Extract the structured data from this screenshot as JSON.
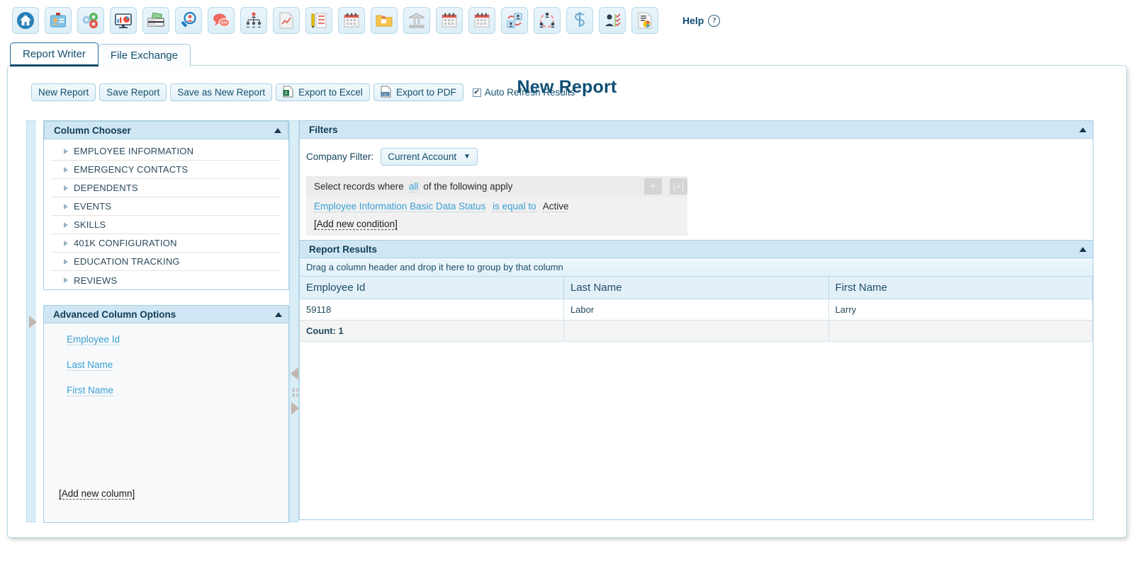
{
  "toolbar": {
    "icons": [
      {
        "name": "home-icon",
        "title": "Home"
      },
      {
        "name": "employee-badge-icon",
        "title": "Employee"
      },
      {
        "name": "settings-gears-icon",
        "title": "Configuration"
      },
      {
        "name": "dashboard-monitor-icon",
        "title": "Dashboard"
      },
      {
        "name": "payroll-money-icon",
        "title": "Payroll"
      },
      {
        "name": "search-person-icon",
        "title": "Search"
      },
      {
        "name": "chat-bubbles-icon",
        "title": "Messages"
      },
      {
        "name": "org-chart-icon",
        "title": "Org Chart"
      },
      {
        "name": "report-chart-icon",
        "title": "Reports"
      },
      {
        "name": "checklist-pen-icon",
        "title": "Checklist"
      },
      {
        "name": "calendar-icon",
        "title": "Calendar"
      },
      {
        "name": "folder-lock-icon",
        "title": "Secure Folder"
      },
      {
        "name": "bank-icon",
        "title": "Bank"
      },
      {
        "name": "calendar-icon-2",
        "title": "Schedule"
      },
      {
        "name": "calendar-icon-3",
        "title": "Attendance"
      },
      {
        "name": "performance-people-icon",
        "title": "Performance"
      },
      {
        "name": "recruiting-network-icon",
        "title": "Recruiting"
      },
      {
        "name": "benefits-caduceus-icon",
        "title": "Benefits"
      },
      {
        "name": "onboarding-check-icon",
        "title": "Onboarding"
      },
      {
        "name": "report-writer-icon",
        "title": "Report Writer"
      }
    ],
    "help_label": "Help",
    "help_icon": "question-mark-icon"
  },
  "tabs": [
    {
      "label": "Report Writer",
      "active": true
    },
    {
      "label": "File Exchange",
      "active": false
    }
  ],
  "actions": {
    "new_report": "New Report",
    "save_report": "Save Report",
    "save_as_new_report": "Save as New Report",
    "export_excel": "Export to Excel",
    "export_pdf": "Export to PDF",
    "auto_refresh": "Auto Refresh Results",
    "auto_refresh_checked": true
  },
  "page_title": "New Report",
  "column_chooser": {
    "header": "Column Chooser",
    "items": [
      "EMPLOYEE INFORMATION",
      "EMERGENCY CONTACTS",
      "DEPENDENTS",
      "EVENTS",
      "SKILLS",
      "401K CONFIGURATION",
      "EDUCATION TRACKING",
      "REVIEWS"
    ]
  },
  "advanced_column_options": {
    "header": "Advanced Column Options",
    "columns": [
      "Employee Id",
      "Last Name",
      "First Name"
    ],
    "add_link": "[Add new column]"
  },
  "filters": {
    "header": "Filters",
    "company_filter_label": "Company Filter:",
    "company_filter_value": "Current Account",
    "select_prefix": "Select records where",
    "match_mode": "all",
    "select_suffix": "of the following apply",
    "add_condition_button": "+",
    "add_group_button": "{+}",
    "conditions": [
      {
        "field": "Employee Information Basic Data Status",
        "operator": "is equal to",
        "value": "Active"
      }
    ],
    "add_condition_link": "[Add new condition]"
  },
  "report_results": {
    "header": "Report Results",
    "group_hint": "Drag a column header and drop it here to group by that column",
    "columns": [
      "Employee Id",
      "Last Name",
      "First Name"
    ],
    "rows": [
      [
        "59118",
        "Labor",
        "Larry"
      ]
    ],
    "footer": [
      "Count: 1",
      "",
      ""
    ]
  },
  "colors": {
    "accent": "#0e4f74",
    "panel_header_bg": "#cfe7f4",
    "link": "#3a9fd4",
    "grid_header_bg": "#e3f0f8"
  }
}
